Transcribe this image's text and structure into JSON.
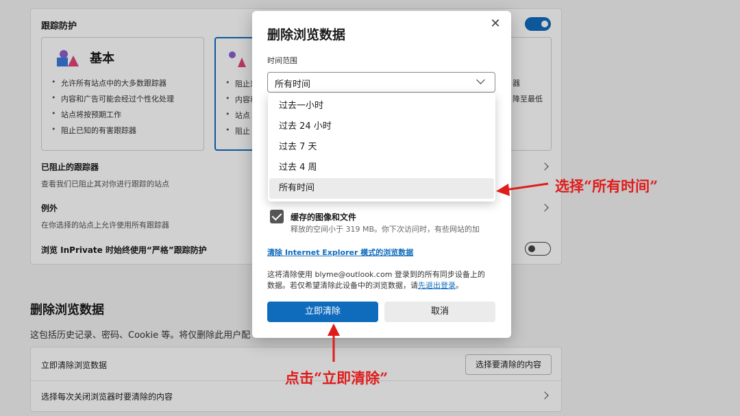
{
  "tracking": {
    "title": "跟踪防护",
    "cards": [
      {
        "name": "基本",
        "bullets": [
          "允许所有站点中的大多数跟踪器",
          "内容和广告可能会经过个性化处理",
          "站点将按预期工作",
          "阻止已知的有害跟踪器"
        ]
      },
      {
        "name": "",
        "bullets": [
          "阻止来",
          "内容和",
          "站点",
          "阻止"
        ]
      },
      {
        "name": "",
        "bullets": [
          "器",
          "降至最低"
        ]
      }
    ],
    "blocked": {
      "title": "已阻止的跟踪器",
      "subtitle": "查看我们已阻止其对你进行跟踪的站点"
    },
    "exceptions": {
      "title": "例外",
      "subtitle": "在你选择的站点上允许使用所有跟踪器"
    },
    "inprivate": {
      "label": "浏览 InPrivate 时始终使用“严格”跟踪防护"
    }
  },
  "clear_section": {
    "heading": "删除浏览数据",
    "description": "这包括历史记录、密码、Cookie 等。将仅删除此用户配",
    "row1_label": "立即清除浏览数据",
    "row1_button": "选择要清除的内容",
    "row2_label": "选择每次关闭浏览器时要清除的内容"
  },
  "dialog": {
    "title": "删除浏览数据",
    "close_glyph": "✕",
    "time_range_label": "时间范围",
    "time_range_value": "所有时间",
    "options": [
      "过去一小时",
      "过去 24 小时",
      "过去 7 天",
      "过去 4 周",
      "所有时间"
    ],
    "cache_title": "缓存的图像和文件",
    "cache_desc": "释放的空间小于 319 MB。你下次访问时，有些网站的加",
    "ie_link": "清除 Internet Explorer 模式的浏览数据",
    "sync_note_1": "这将清除使用 blyme@outlook.com 登录到的所有同步设备上的",
    "sync_note_2": "数据。若仅希望清除此设备中的浏览数据，请",
    "sign_out_link": "先退出登录",
    "sync_note_end": "。",
    "clear_button": "立即清除",
    "cancel_button": "取消"
  },
  "annotations": {
    "select_all_time": "选择“所有时间”",
    "click_clear_now": "点击“立即清除”"
  },
  "colors": {
    "accent": "#0f6cbd",
    "annotation": "#e01b1b"
  }
}
